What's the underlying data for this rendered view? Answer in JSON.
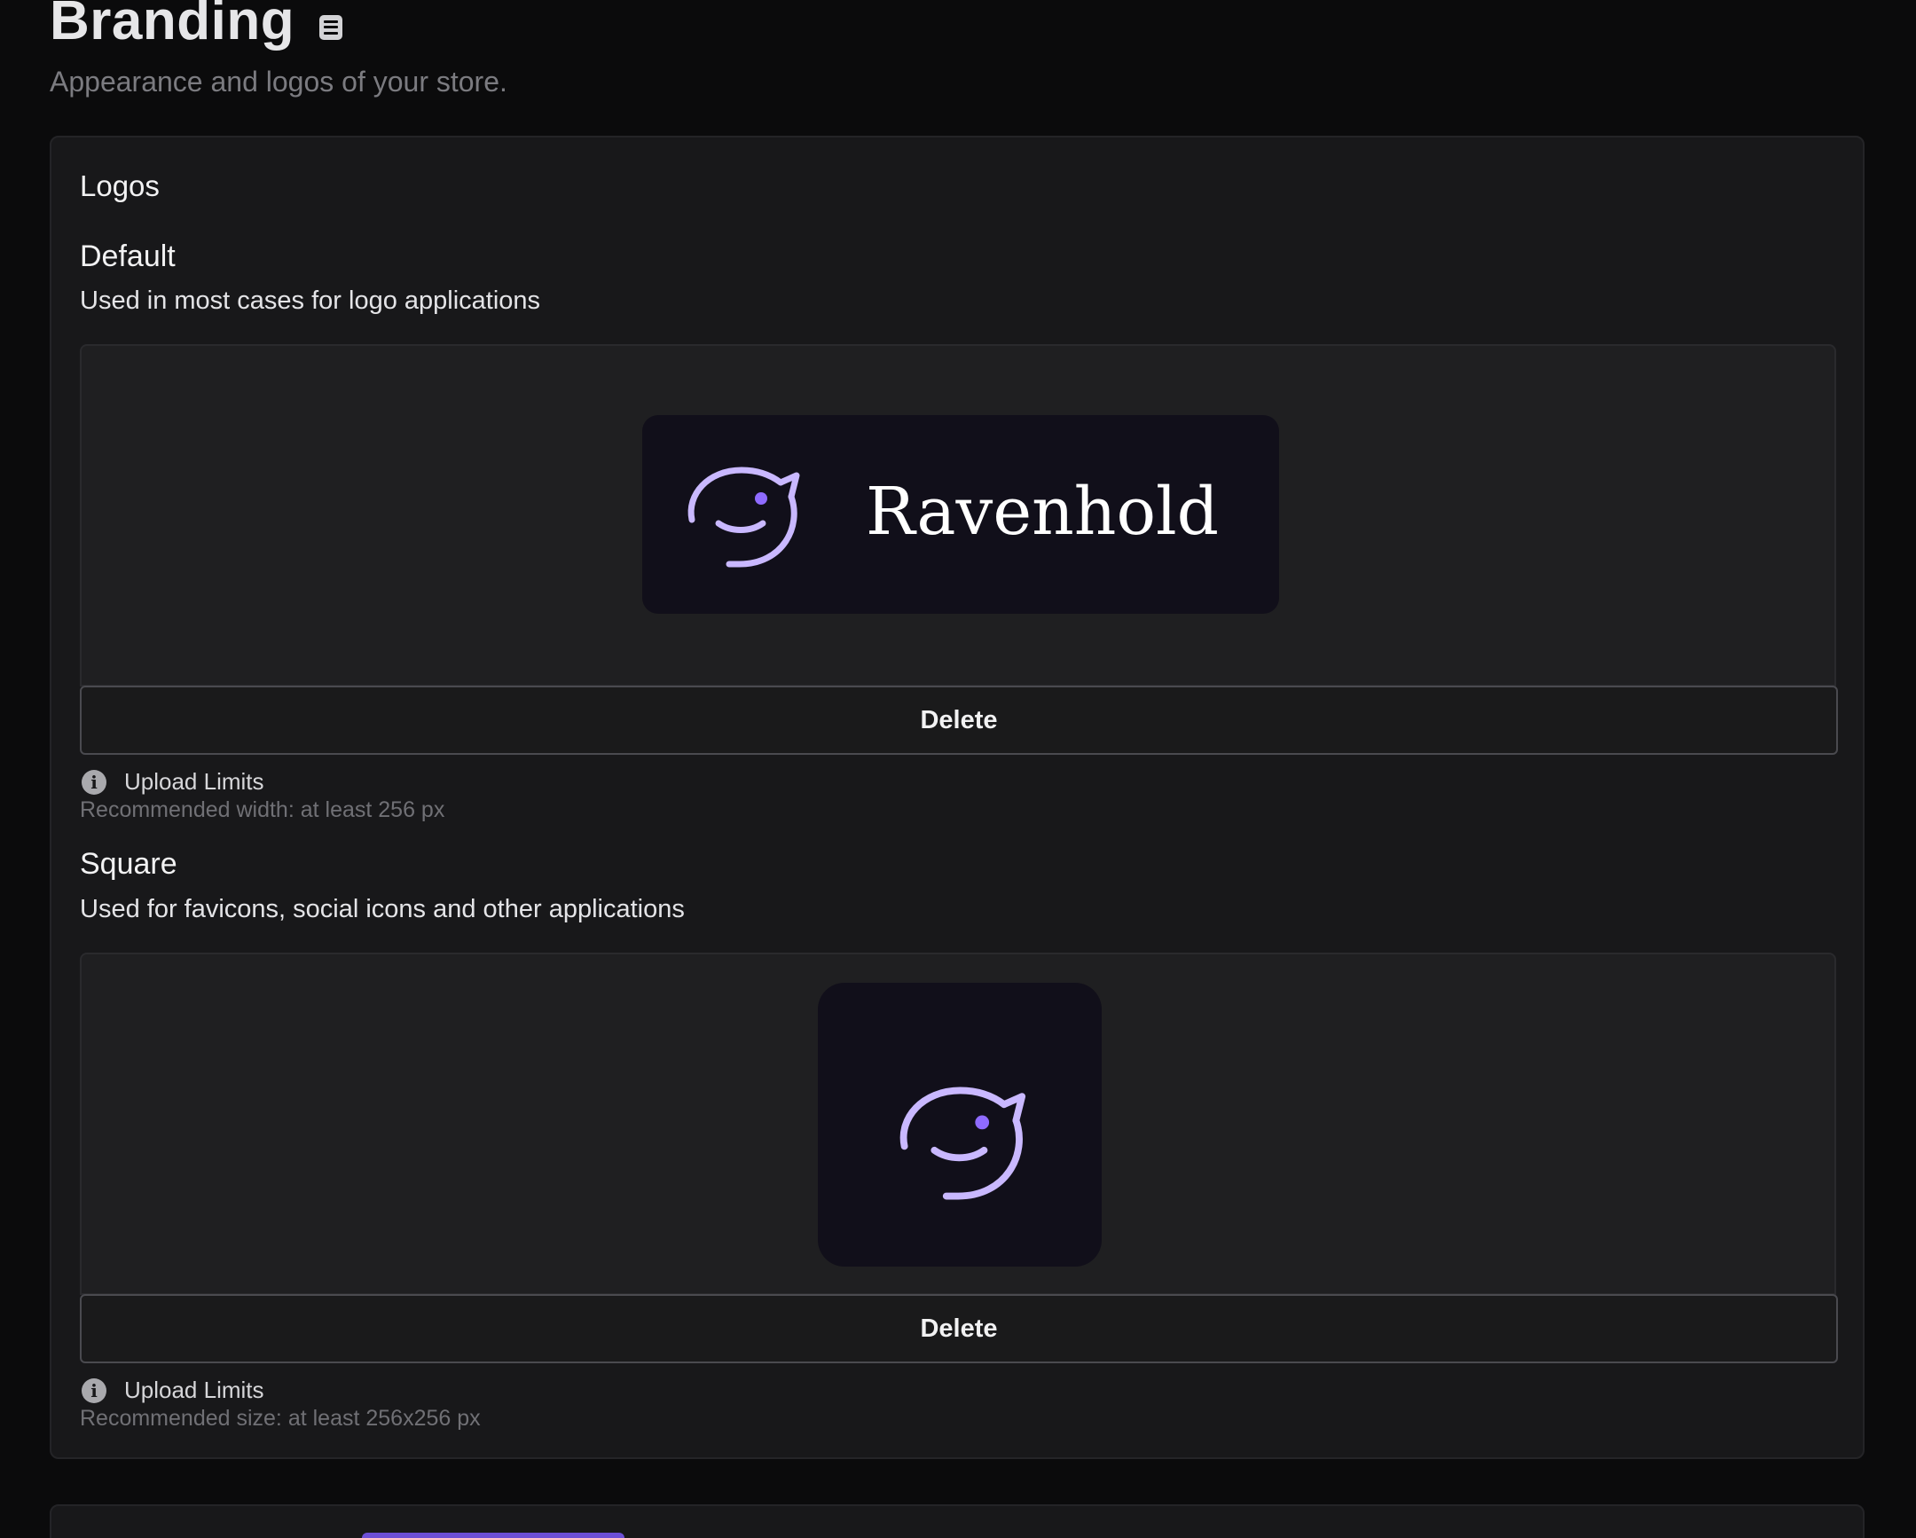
{
  "header": {
    "title": "Branding",
    "subtitle": "Appearance and logos of your store.",
    "doc_icon": "book-icon"
  },
  "logos_card": {
    "title": "Logos",
    "default": {
      "title": "Default",
      "description": "Used in most cases for logo applications",
      "logo_wordmark": "Ravenhold",
      "delete_label": "Delete",
      "limits_title": "Upload Limits",
      "limits_text": "Recommended width: at least 256 px"
    },
    "square": {
      "title": "Square",
      "description": "Used for favicons, social icons and other applications",
      "delete_label": "Delete",
      "limits_title": "Upload Limits",
      "limits_text": "Recommended size: at least 256x256 px"
    }
  },
  "colors": {
    "background": "#0b0b0c",
    "card": "#18181a",
    "logo_background": "#110f1a",
    "logo_mark": "#c9b8ff",
    "logo_eye": "#8f6bff",
    "accent": "#6d4fd6"
  },
  "icons": {
    "info": "info-icon",
    "logo_mark": "raven-logo-mark"
  }
}
